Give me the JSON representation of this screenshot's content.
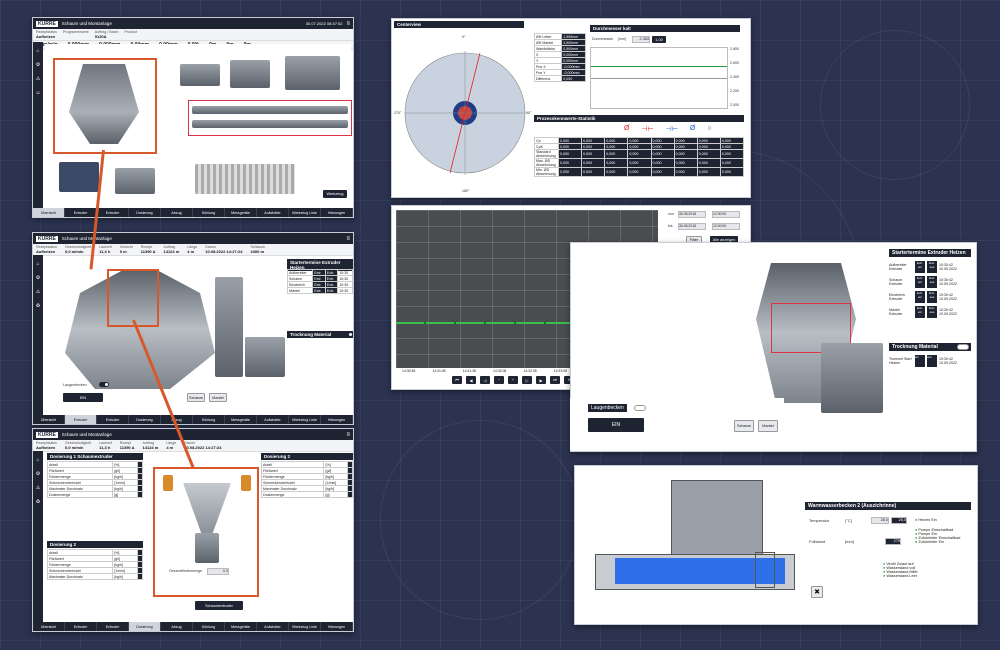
{
  "hmi1": {
    "brand": "KURRE",
    "title": "Schaum und Montanlage",
    "info": [
      {
        "k": "Rezeptstatus",
        "v": "Aufheizen"
      },
      {
        "k": "Programmname",
        "v": ""
      },
      {
        "k": "Auftrag / Batch",
        "v": "9120A"
      },
      {
        "k": "Produkt",
        "v": ""
      },
      {
        "k": "Datum",
        "v": "30.07.2022 08:47:02"
      }
    ],
    "row2": [
      "3,0m/min",
      "0,000mm",
      "0,000mm",
      "0,00mm",
      "0,00mm",
      "0,0%",
      "0m",
      "0m",
      "0m",
      "0m",
      "0m"
    ],
    "tabs": [
      "Übersicht",
      "Extruder",
      "Extruder",
      "Dosierung",
      "Abzug",
      "Kühlung",
      "Messgeräte",
      "Aufwickler",
      "Werkzeug Liste",
      "Heizungen"
    ],
    "footer_btn": "Werkzeug"
  },
  "hmi2": {
    "brand": "KURRE",
    "title": "Schaum und Montanlage",
    "info": [
      {
        "k": "Rezeptstatus",
        "v": "Aufheizen"
      },
      {
        "k": "Geschwindigkeit",
        "v": "0,0 m/min"
      },
      {
        "k": "Laufzeit",
        "v": "11,3 h"
      },
      {
        "k": "Gewicht",
        "v": "0 m"
      },
      {
        "k": "Rezept",
        "v": "11390 A"
      },
      {
        "k": "Auftrag",
        "v": "14124 m"
      },
      {
        "k": "Länge",
        "v": "4 m"
      },
      {
        "k": "Datum",
        "v": "10.08.2022 14:27:24"
      },
      {
        "k": "Schlauch",
        "v": "2400 m"
      }
    ],
    "side_title": "Startertermine Extruder Heizen",
    "trock_title": "Trocknung Material",
    "laser_label": "Laugenbecken",
    "ein_label": "EIN",
    "btn1": "Schaum",
    "btn2": "Mantel",
    "tabs": [
      "Übersicht",
      "Extruder",
      "Extruder",
      "Dosierung",
      "Abzug",
      "Kühlung",
      "Messgeräte",
      "Aufwickler",
      "Werkzeug Liste",
      "Heizungen"
    ]
  },
  "hmi3": {
    "brand": "KURRE",
    "title": "Schaum und Montanlage",
    "left_title1": "Dosierung 1  Schaumextruder",
    "left_title2": "Dosierung 2",
    "right_title": "Dosierung 2",
    "fields": [
      "Anteil",
      "Fließwert",
      "Fördermenge",
      "Schneckendrehzahl",
      "Maximaler Durchsatz",
      "Dosiermenge"
    ],
    "mini_label": "Gesamtfördermenge",
    "mini_value": "0,0",
    "schaum_btn": "Schaumextruder",
    "tabs": [
      "Übersicht",
      "Extruder",
      "Extruder",
      "Dosierung",
      "Abzug",
      "Kühlung",
      "Messgeräte",
      "Aufwickler",
      "Werkzeug Liste",
      "Heizungen"
    ]
  },
  "center": {
    "title": "Centerview",
    "rows": [
      {
        "k": "ØH Leiter",
        "v": "1,999mm"
      },
      {
        "k": "ØH Mantel",
        "v": "3,500mm"
      },
      {
        "k": "Wandstärke",
        "v": "0,500mm"
      },
      {
        "k": "X",
        "v": "0,000mm"
      },
      {
        "k": "Y",
        "v": "0,000mm"
      },
      {
        "k": "Pos X",
        "v": "-0,000mm"
      },
      {
        "k": "Pos Y",
        "v": "-0,000mm"
      },
      {
        "k": "Differenz",
        "v": "0,000"
      }
    ],
    "angles": [
      "0°",
      "90°",
      "180°",
      "270°"
    ],
    "diam_title": "Durchmesser kalt",
    "diam_label": "Durchmesser",
    "diam_unit": "[mm]",
    "diam_value": "2,383",
    "diam_btn": "1,00",
    "stat_title": "Prozesskennwerte-Statistik",
    "stat_rows": [
      "Cp",
      "CpK",
      "Standard Abweichung",
      "Max. ØD Abweichung",
      "Min. ØD Abweichung"
    ],
    "ticks": [
      "2,800",
      "2,600",
      "2,400",
      "2,200",
      "2,000"
    ],
    "chart_dates": [
      "30.08.2018",
      "30.08.2018"
    ],
    "chart_times": [
      "12:00:00",
      "12:00:00"
    ],
    "filter_btn": "Filter",
    "export_btn": "Alle anzeigen",
    "zoom_btns": [
      "1 min",
      "1 Std",
      "24 Std",
      "7 d"
    ],
    "xtimes": [
      "14:30:38",
      "14:31:08",
      "14:31:38",
      "14:32:08",
      "14:32:38",
      "14:33:08",
      "14:33:38",
      "14:34:08",
      "14:34:38"
    ],
    "legend": [
      "Schaum: Messwert",
      "Schaum: Sollwert",
      "Mantel: Messwert",
      "Mantel: Sollwert",
      "Leiter: Messwert",
      "Extruder"
    ],
    "legend_colors": [
      "#d4a500",
      "#7e4cc0",
      "#1b5cd0",
      "#2a9a3c",
      "#e07b1a",
      "#c23a3a"
    ],
    "zoom_label": "Zeitraster"
  },
  "heat": {
    "title": "Startertermine Extruder Heizen",
    "rows": [
      "Aufbereiter Extruder",
      "Schaum Extruder",
      "Einstreich Extruder",
      "Mantel Extruder"
    ],
    "time": "10:30:42",
    "date": "10.09.2022",
    "trock": "Trocknung Material",
    "trock_row": "Trommel Start Heizen",
    "lauge": "Laugenbecken",
    "ein": "EIN",
    "b1": "Schaum",
    "b2": "Mantel"
  },
  "water": {
    "title": "Warmwasserbecken 2 (Auszichrinne)",
    "temp_label": "Temperatur",
    "temp_unit": "[°C]",
    "temp_val": "28,0",
    "temp_set": "28,0",
    "fill_label": "Füllstand",
    "fill_unit": "[mm]",
    "fill_val": "275",
    "status1": [
      "Heizen Ein"
    ],
    "status2": [
      "Pumpe Einschaltbad",
      "Pumpe Ein",
      "Zufuhrleiter Einschaltbad",
      "Zufuhrleiter Ein"
    ],
    "status3": [
      "Ventil Zulauf auf",
      "Wasserstand voll",
      "Wasserstand Mitte",
      "Wasserstand Leer"
    ]
  }
}
